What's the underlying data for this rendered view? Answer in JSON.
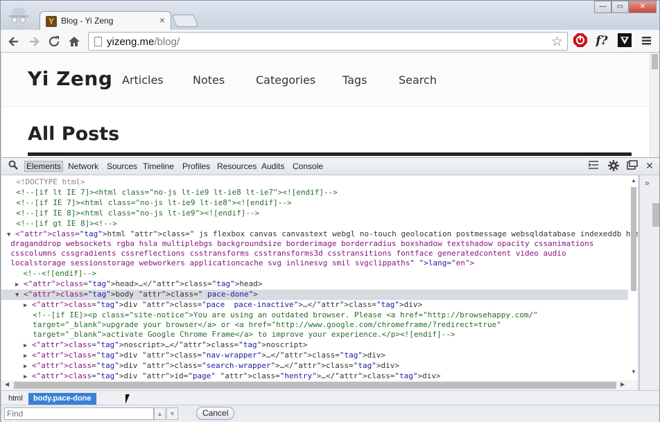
{
  "browser": {
    "tab_title": "Blog - Yi Zeng",
    "tab_favicon": "Y",
    "tab_close": "×",
    "url_host": "yizeng.me",
    "url_path": "/blog/",
    "window_controls": [
      "—",
      "▭",
      "✕"
    ],
    "icons": [
      "incognito-icon",
      "back-arrow-icon",
      "forward-arrow-icon",
      "reload-icon",
      "home-icon",
      "star-icon",
      "stop-sign-extension-icon",
      "function-extension-icon",
      "vimium-extension-icon",
      "menu-icon"
    ],
    "ext_function_label": "f?"
  },
  "site": {
    "brand": "Yi Zeng",
    "nav": [
      "Articles",
      "Notes",
      "Categories",
      "Tags",
      "Search"
    ],
    "heading": "All Posts"
  },
  "devtools": {
    "tabs": [
      "Elements",
      "Network",
      "Sources",
      "Timeline",
      "Profiles",
      "Resources",
      "Audits",
      "Console"
    ],
    "active_tab": "Elements",
    "breadcrumbs": [
      "html",
      "body.pace-done"
    ],
    "active_breadcrumb": "body.pace-done",
    "find_placeholder": "Find",
    "cancel_label": "Cancel"
  },
  "code_lines": [
    "<!DOCTYPE html>",
    "<!--[if lt IE 7]><html class=\"no-js lt-ie9 lt-ie8 lt-ie7\"><![endif]-->",
    "<!--[if IE 7]><html class=\"no-js lt-ie9 lt-ie8\"><![endif]-->",
    "<!--[if IE 8]><html class=\"no-js lt-ie9\"><![endif]-->",
    "<!--[if gt IE 8]><!-->",
    "<html class=\" js flexbox canvas canvastext webgl no-touch geolocation postmessage websqldatabase indexeddb hashchange history",
    "draganddrop websockets rgba hsla multiplebgs backgroundsize borderimage borderradius boxshadow textshadow opacity cssanimations",
    "csscolumns cssgradients cssreflections csstransforms csstransforms3d csstransitions fontface generatedcontent video audio",
    "localstorage sessionstorage webworkers applicationcache svg inlinesvg smil svgclippaths\" lang=\"en\">",
    "<!--<![endif]-->",
    "<head>…</head>",
    "<body class=\" pace-done\">",
    "<div class=\"pace  pace-inactive\">…</div>",
    "<!--[if IE]><p class=\"site-notice\">You are using an outdated browser. Please <a href=\"http://browsehappy.com/\"",
    "target=\"_blank\">upgrade your browser</a> or <a href=\"http://www.google.com/chromeframe/?redirect=true\"",
    "target=\"_blank\">activate Google Chrome Frame</a> to improve your experience.</p><![endif]-->",
    "<noscript>…</noscript>",
    "<div class=\"nav-wrapper\">…</div>",
    "<div class=\"search-wrapper\">…</div>",
    "<div id=\"page\" class=\"hentry\">…</div>"
  ]
}
